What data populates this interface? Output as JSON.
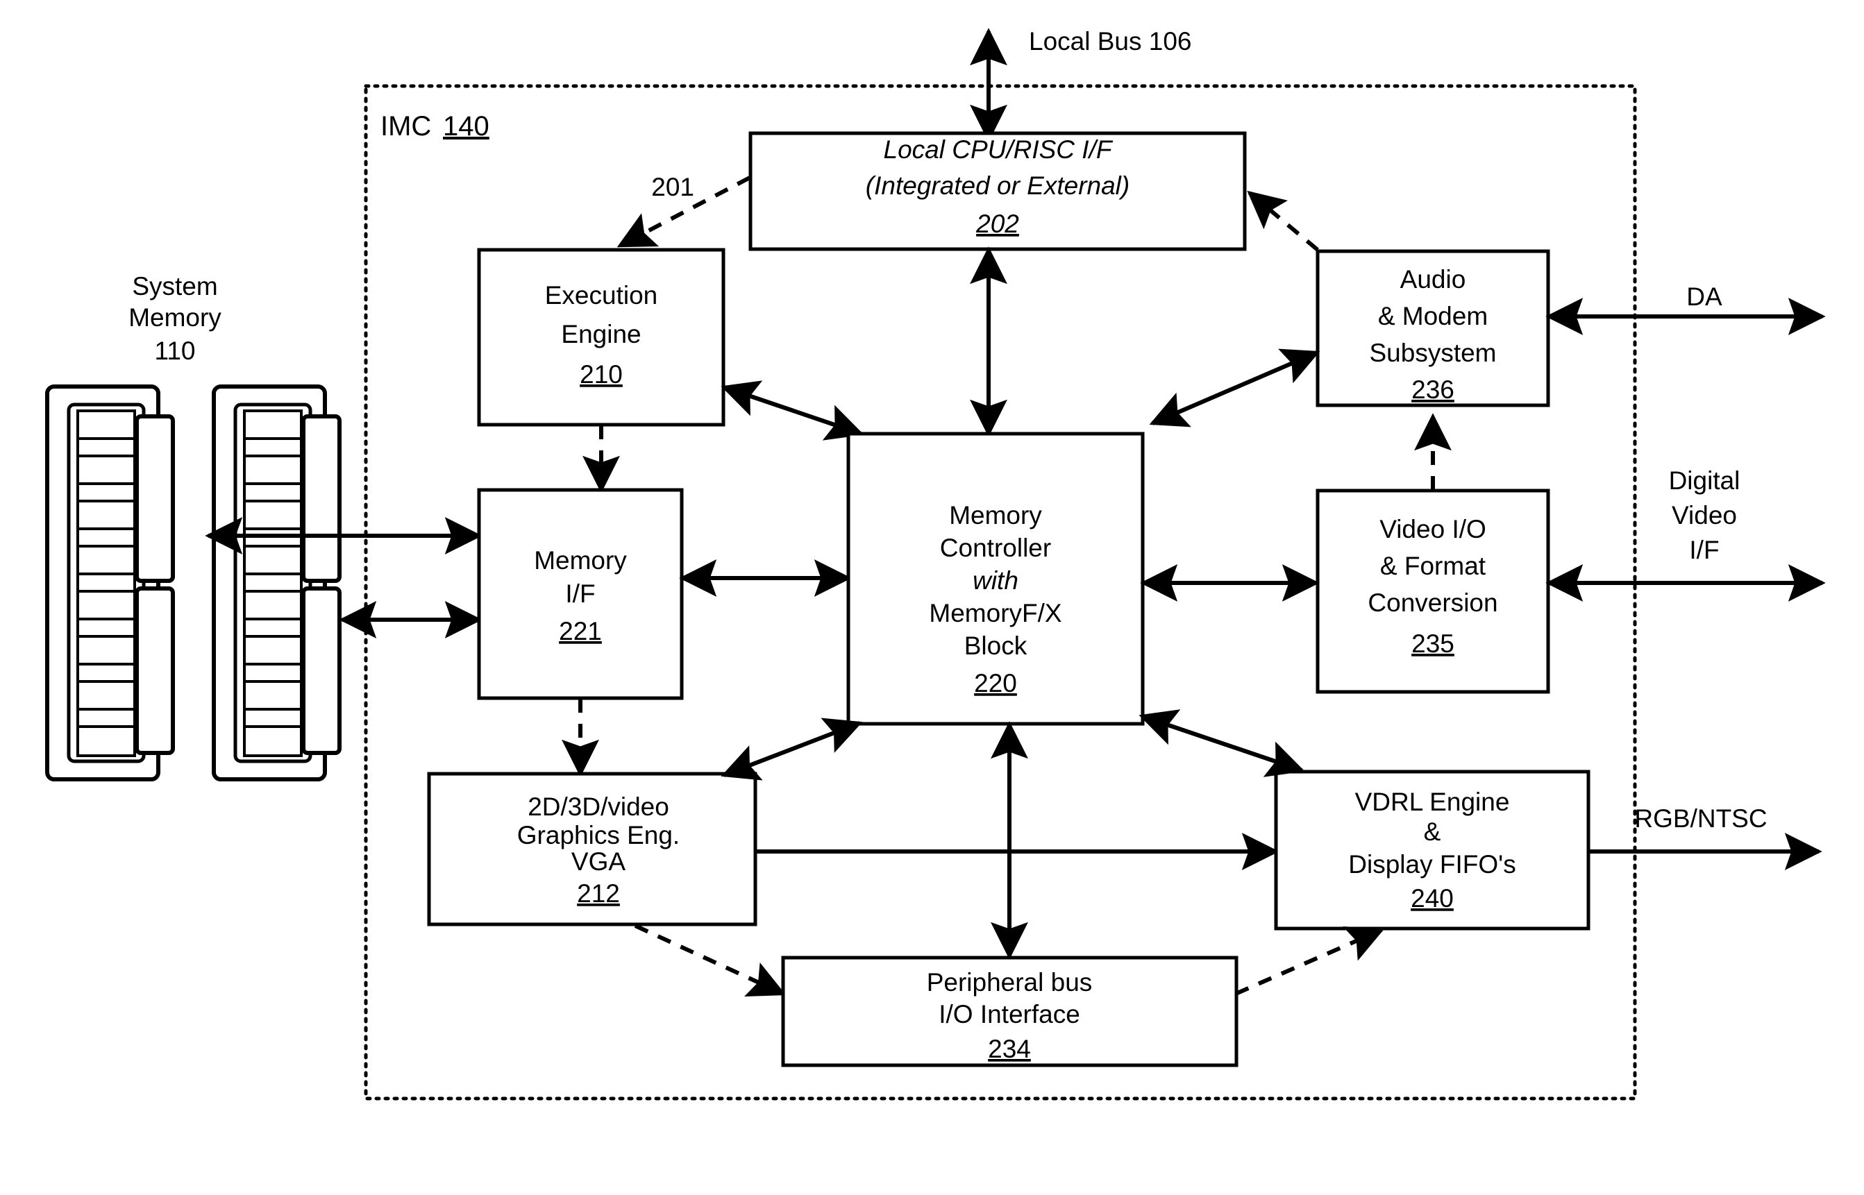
{
  "figure": {
    "boundary_label": "IMC",
    "boundary_ref": "140",
    "top_bus_label": "Local Bus 106",
    "callout_201": "201"
  },
  "system_memory": {
    "line1": "System",
    "line2": "Memory",
    "ref": "110"
  },
  "blocks": {
    "cpu_if": {
      "line1": "Local CPU/RISC I/F",
      "line2": "(Integrated or External)",
      "ref": "202"
    },
    "execution_engine": {
      "line1": "Execution",
      "line2": "Engine",
      "ref": "210"
    },
    "audio_modem": {
      "line1": "Audio",
      "line2": "& Modem",
      "line3": "Subsystem",
      "ref": "236"
    },
    "memory_if": {
      "line1": "Memory",
      "line2": "I/F",
      "ref": "221"
    },
    "memory_controller": {
      "line1": "Memory",
      "line2": "Controller",
      "line3": "with",
      "line4": "MemoryF/X",
      "line5": "Block",
      "ref": "220"
    },
    "video_io": {
      "line1": "Video I/O",
      "line2": "& Format",
      "line3": "Conversion",
      "ref": "235"
    },
    "graphics_engine": {
      "line1": "2D/3D/video",
      "line2": "Graphics Eng.",
      "line3": "VGA",
      "ref": "212"
    },
    "vdrl_engine": {
      "line1": "VDRL Engine",
      "line2": "&",
      "line3": "Display FIFO's",
      "ref": "240"
    },
    "peripheral_bus": {
      "line1": "Peripheral bus",
      "line2": "I/O Interface",
      "ref": "234"
    }
  },
  "external_ports": {
    "da": "DA",
    "digital_video_1": "Digital",
    "digital_video_2": "Video",
    "digital_video_3": "I/F",
    "rgb_ntsc": "RGB/NTSC"
  },
  "colors": {
    "stroke": "#000000",
    "background": "#ffffff"
  }
}
